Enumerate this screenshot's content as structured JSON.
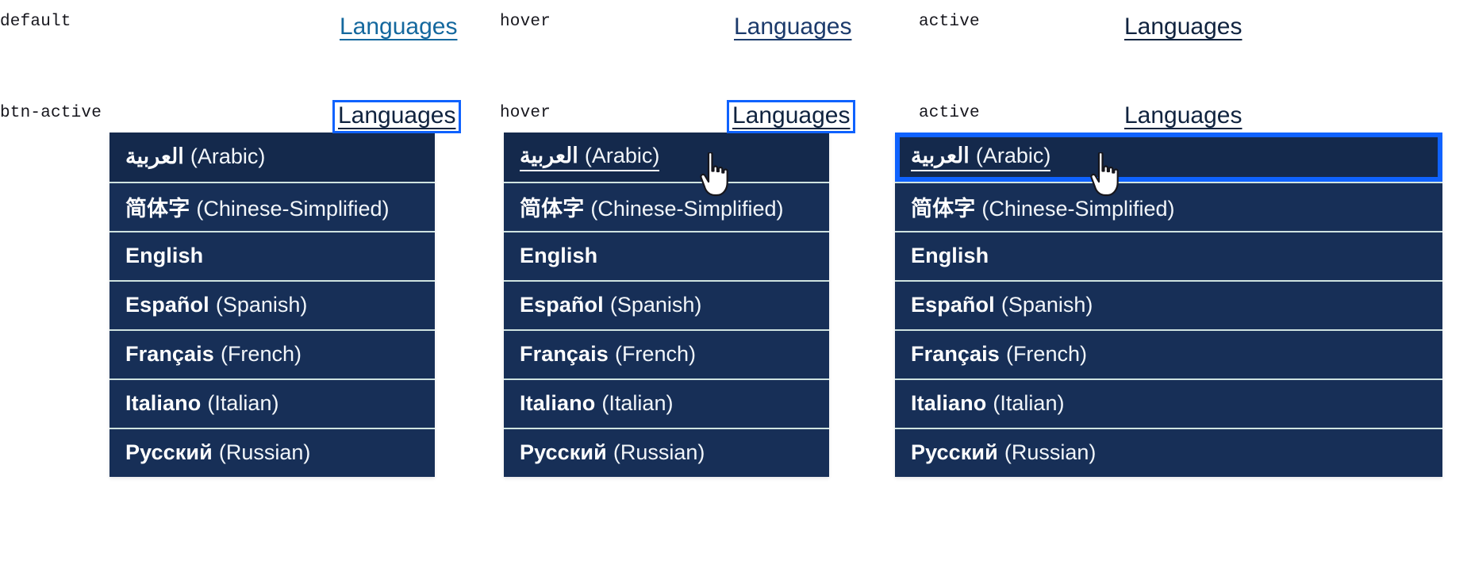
{
  "meta": {
    "title": "Language selector — interaction states"
  },
  "palette": {
    "page_bg": "#ffffff",
    "link_default": "#14689e",
    "link_hover": "#1b3a6b",
    "link_active": "#10233f",
    "focus_blue": "#0f62fe",
    "panel_navy": "#172f57",
    "panel_navy_dark": "#14294c",
    "divider": "#cfe3e0",
    "row_text": "#ffffff",
    "label_text": "#16161d"
  },
  "trigger": {
    "label": "Languages"
  },
  "languages": [
    {
      "native": "العربية",
      "english": "(Arabic)"
    },
    {
      "native": "简体字",
      "english": "(Chinese-Simplified)"
    },
    {
      "native": "English",
      "english": ""
    },
    {
      "native": "Español",
      "english": "(Spanish)"
    },
    {
      "native": "Français",
      "english": "(French)"
    },
    {
      "native": "Italiano",
      "english": "(Italian)"
    },
    {
      "native": "Русский",
      "english": "(Russian)"
    }
  ],
  "top_row": [
    {
      "state_label": "default"
    },
    {
      "state_label": "hover"
    },
    {
      "state_label": "active"
    }
  ],
  "bottom_row": [
    {
      "state_label": "btn-active"
    },
    {
      "state_label": "hover"
    },
    {
      "state_label": "active"
    }
  ]
}
